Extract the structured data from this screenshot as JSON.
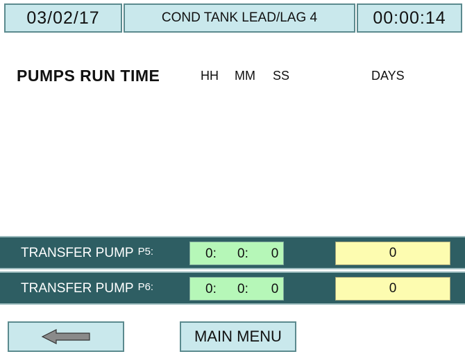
{
  "header": {
    "date": "03/02/17",
    "title": "COND TANK LEAD/LAG 4",
    "time": "00:00:14"
  },
  "run_time": {
    "title": "PUMPS RUN TIME",
    "col_hh": "HH",
    "col_mm": "MM",
    "col_ss": "SS",
    "col_days": "DAYS"
  },
  "pumps": [
    {
      "label": "TRANSFER PUMP",
      "id": "P5:",
      "hh": "0:",
      "mm": "0:",
      "ss": "0",
      "days": "0"
    },
    {
      "label": "TRANSFER PUMP",
      "id": "P6:",
      "hh": "0:",
      "mm": "0:",
      "ss": "0",
      "days": "0"
    }
  ],
  "nav": {
    "back_icon": "arrow-left-icon",
    "main_menu_label": "MAIN MENU"
  },
  "colors": {
    "header_bg": "#c9e8ec",
    "row_bg": "#2e5e63",
    "time_bg": "#b6f7b8",
    "days_bg": "#fdfcb0"
  }
}
